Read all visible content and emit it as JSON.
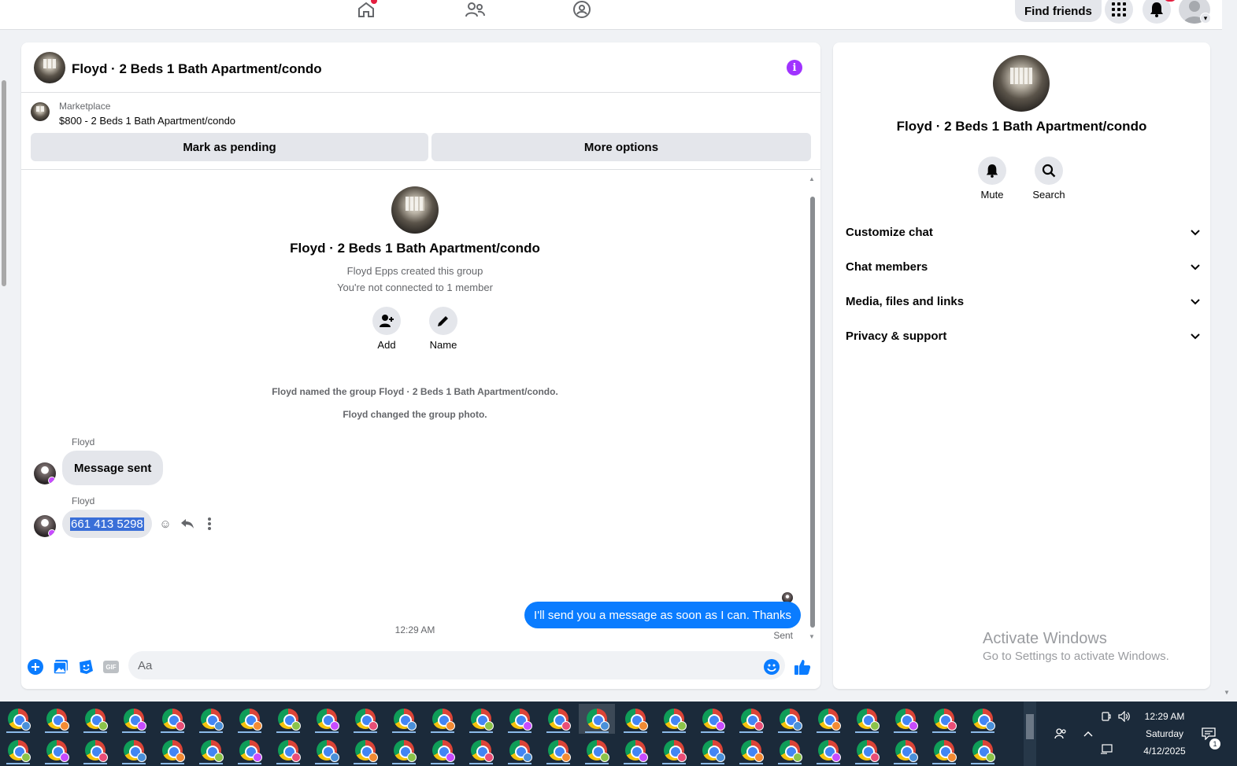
{
  "topnav": {
    "find_friends": "Find friends",
    "icons": [
      "home-icon",
      "friends-icon",
      "groups-icon",
      "menu-grid-icon",
      "notifications-bell-icon",
      "profile-avatar"
    ]
  },
  "chat": {
    "title": "Floyd · 2 Beds 1 Bath Apartment/condo",
    "marketplace_label": "Marketplace",
    "marketplace_item": "$800 - 2 Beds 1 Bath Apartment/condo",
    "mark_pending": "Mark as pending",
    "more_options": "More options",
    "group_title": "Floyd · 2 Beds 1 Bath Apartment/condo",
    "created_by": "Floyd Epps created this group",
    "not_connected": "You're not connected to 1 member",
    "add_label": "Add",
    "name_label": "Name",
    "system_1": "Floyd named the group Floyd · 2 Beds 1 Bath Apartment/condo.",
    "system_2": "Floyd changed the group photo.",
    "msg1_sender": "Floyd",
    "msg1_text": "Message sent",
    "msg2_sender": "Floyd",
    "msg2_text": "661 413 5298",
    "time": "12:29 AM",
    "out_text": "I'll send you a message as soon as I can. Thanks",
    "sent": "Sent",
    "input_placeholder": "Aa",
    "gif": "GIF"
  },
  "right_panel": {
    "title": "Floyd · 2 Beds 1 Bath Apartment/condo",
    "mute": "Mute",
    "search": "Search",
    "sections": [
      "Customize chat",
      "Chat members",
      "Media, files and links",
      "Privacy & support"
    ]
  },
  "watermark": {
    "title": "Activate Windows",
    "subtitle": "Go to Settings to activate Windows."
  },
  "tray": {
    "time": "12:29 AM",
    "day": "Saturday",
    "date": "4/12/2025",
    "notif_count": "1"
  },
  "colors": {
    "accent_blue": "#0a7cff",
    "info_purple": "#a033ff",
    "badge_red": "#e41e3f"
  }
}
